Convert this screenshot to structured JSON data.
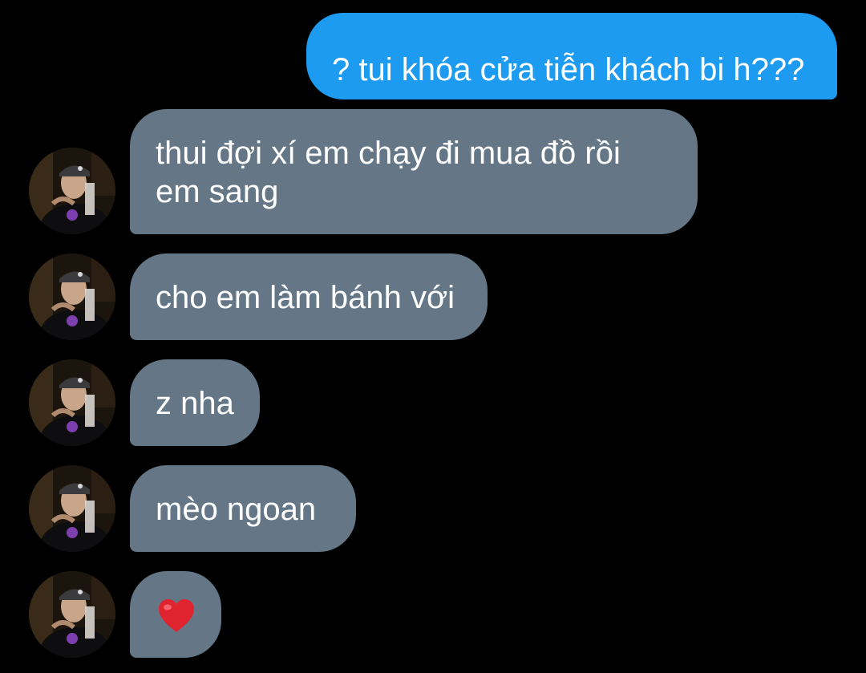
{
  "theme": {
    "background": "#000000",
    "sent_bubble_color": "#1d9bf0",
    "received_bubble_color": "#657786",
    "text_color": "#ffffff",
    "heart_color": "#e0242f"
  },
  "messages": [
    {
      "direction": "sent",
      "text": "? tui khóa cửa tiễn khách bi h???"
    },
    {
      "direction": "received",
      "lines": [
        "thui đợi xí em chạy đi mua đồ rồi",
        "em sang"
      ]
    },
    {
      "direction": "received",
      "text": "cho em làm bánh với"
    },
    {
      "direction": "received",
      "text": "z nha"
    },
    {
      "direction": "received",
      "text": "mèo ngoan"
    },
    {
      "direction": "received",
      "emoji": "red-heart-icon"
    }
  ],
  "contact": {
    "avatar": "user-avatar"
  }
}
